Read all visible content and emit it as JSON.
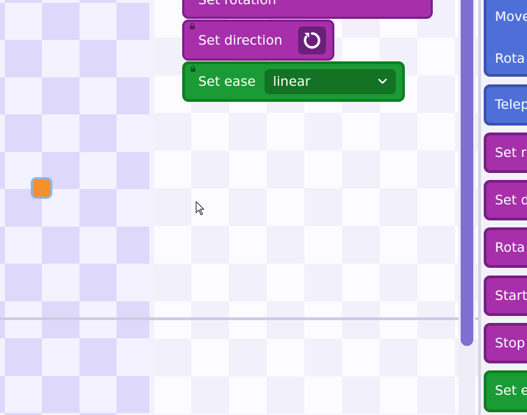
{
  "workspace": {
    "blocks": {
      "set_rotation": {
        "label": "Set rotation"
      },
      "set_direction": {
        "label": "Set direction",
        "icon": "rotate-clockwise-icon"
      },
      "set_ease": {
        "label": "Set ease",
        "value": "linear"
      }
    }
  },
  "palette": {
    "items": [
      {
        "label": "Move",
        "color": "#4f6fd8"
      },
      {
        "label": "Rota",
        "color": "#4f6fd8"
      },
      {
        "label": "Telep",
        "color": "#4f6fd8"
      },
      {
        "label": "Set r",
        "color": "#a72faa"
      },
      {
        "label": "Set d",
        "color": "#a72faa"
      },
      {
        "label": "Rota",
        "color": "#a72faa"
      },
      {
        "label": "Start",
        "color": "#a72faa"
      },
      {
        "label": "Stop",
        "color": "#a72faa"
      },
      {
        "label": "Set e",
        "color": "#1a9b35"
      }
    ]
  },
  "stage": {
    "sprite_color": "#f7902a"
  }
}
